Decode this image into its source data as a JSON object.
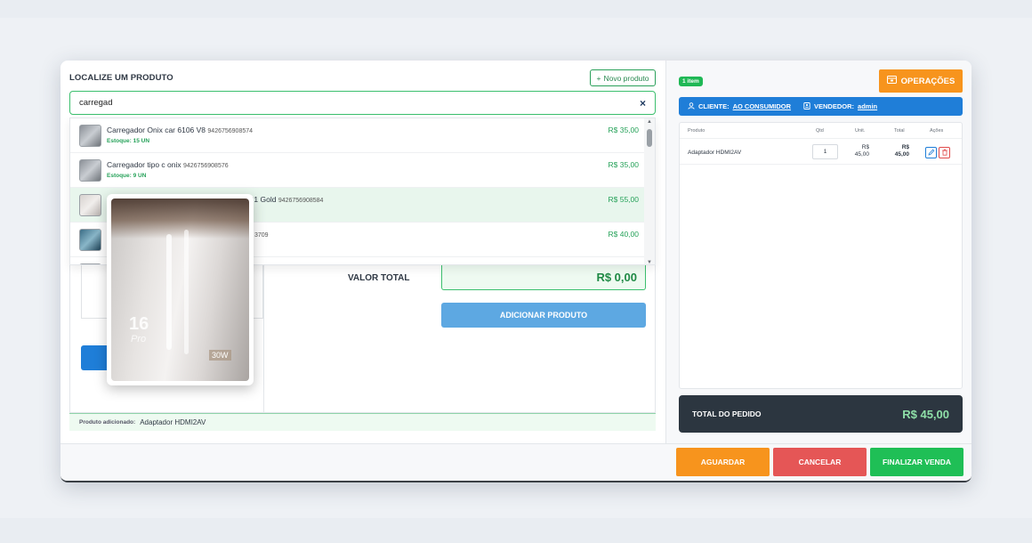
{
  "search_panel": {
    "title": "LOCALIZE UM PRODUTO",
    "new_product_label": "Novo produto",
    "search_value": "carregad",
    "clear_label": "×",
    "results": [
      {
        "name": "Carregador Onix car 6106 V8",
        "code": "9426756908574",
        "stock": "Estoque: 15 UN",
        "price": "R$ 35,00"
      },
      {
        "name": "Carregador tipo c onix",
        "code": "9426756908576",
        "stock": "Estoque: 9 UN",
        "price": "R$ 35,00"
      },
      {
        "name": "A31 Gold",
        "code": "9426756908584",
        "stock": "",
        "price": "R$ 55,00"
      },
      {
        "name": "",
        "code": "3709",
        "stock": "",
        "price": "R$ 40,00"
      }
    ]
  },
  "form": {
    "valor_total_label": "VALOR TOTAL",
    "valor_total_value": "R$ 0,00",
    "add_button_label": "ADICIONAR PRODUTO",
    "added_label": "Produto adicionado:",
    "added_value": "Adaptador HDMI2AV"
  },
  "preview": {
    "big_text": "16",
    "sub_text": "Pro",
    "badge_text": "30W"
  },
  "order": {
    "items_badge": "1 item",
    "operations_label": "OPERAÇÕES",
    "client_label": "CLIENTE:",
    "client_value": "AO CONSUMIDOR",
    "seller_label": "VENDEDOR:",
    "seller_value": "admin",
    "columns": {
      "product": "Produto",
      "qty": "Qtd",
      "unit": "Unit.",
      "total": "Total",
      "actions": "Ações"
    },
    "rows": [
      {
        "product": "Adaptador HDMI2AV",
        "qty": "1",
        "unit_currency": "R$",
        "unit_value": "45,00",
        "total_currency": "R$",
        "total_value": "45,00"
      }
    ],
    "total_label": "TOTAL DO PEDIDO",
    "total_value": "R$ 45,00"
  },
  "footer": {
    "wait_label": "AGUARDAR",
    "cancel_label": "CANCELAR",
    "finish_label": "FINALIZAR VENDA"
  },
  "colors": {
    "primary": "#1f7ed8",
    "success": "#1fbf56",
    "warning": "#f7941d",
    "danger": "#e55656",
    "dark": "#2c3640"
  }
}
